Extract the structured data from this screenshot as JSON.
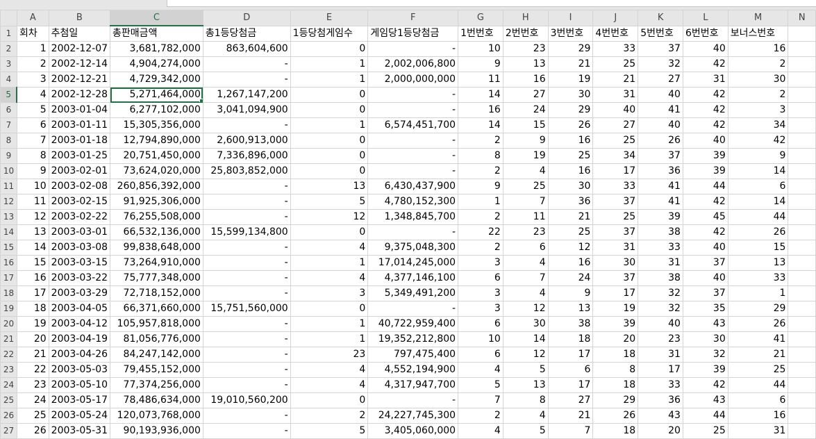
{
  "columns": [
    "A",
    "B",
    "C",
    "D",
    "E",
    "F",
    "G",
    "H",
    "I",
    "J",
    "K",
    "L",
    "M",
    "N"
  ],
  "header_row": [
    "회차",
    "추첨일",
    "총판매금액",
    "총1등당첨금",
    "1등당첨게임수",
    "게임당1등당첨금",
    "1번번호",
    "2번번호",
    "3번번호",
    "4번번호",
    "5번번호",
    "6번번호",
    "보너스번호"
  ],
  "rows": [
    [
      "1",
      "2002-12-07",
      "3,681,782,000",
      "863,604,600",
      "0",
      "-",
      "10",
      "23",
      "29",
      "33",
      "37",
      "40",
      "16"
    ],
    [
      "2",
      "2002-12-14",
      "4,904,274,000",
      "-",
      "1",
      "2,002,006,800",
      "9",
      "13",
      "21",
      "25",
      "32",
      "42",
      "2"
    ],
    [
      "3",
      "2002-12-21",
      "4,729,342,000",
      "-",
      "1",
      "2,000,000,000",
      "11",
      "16",
      "19",
      "21",
      "27",
      "31",
      "30"
    ],
    [
      "4",
      "2002-12-28",
      "5,271,464,000",
      "1,267,147,200",
      "0",
      "-",
      "14",
      "27",
      "30",
      "31",
      "40",
      "42",
      "2"
    ],
    [
      "5",
      "2003-01-04",
      "6,277,102,000",
      "3,041,094,900",
      "0",
      "-",
      "16",
      "24",
      "29",
      "40",
      "41",
      "42",
      "3"
    ],
    [
      "6",
      "2003-01-11",
      "15,305,356,000",
      "-",
      "1",
      "6,574,451,700",
      "14",
      "15",
      "26",
      "27",
      "40",
      "42",
      "34"
    ],
    [
      "7",
      "2003-01-18",
      "12,794,890,000",
      "2,600,913,000",
      "0",
      "-",
      "2",
      "9",
      "16",
      "25",
      "26",
      "40",
      "42"
    ],
    [
      "8",
      "2003-01-25",
      "20,751,450,000",
      "7,336,896,000",
      "0",
      "-",
      "8",
      "19",
      "25",
      "34",
      "37",
      "39",
      "9"
    ],
    [
      "9",
      "2003-02-01",
      "73,624,020,000",
      "25,803,852,000",
      "0",
      "-",
      "2",
      "4",
      "16",
      "17",
      "36",
      "39",
      "14"
    ],
    [
      "10",
      "2003-02-08",
      "260,856,392,000",
      "-",
      "13",
      "6,430,437,900",
      "9",
      "25",
      "30",
      "33",
      "41",
      "44",
      "6"
    ],
    [
      "11",
      "2003-02-15",
      "91,925,306,000",
      "-",
      "5",
      "4,780,152,300",
      "1",
      "7",
      "36",
      "37",
      "41",
      "42",
      "14"
    ],
    [
      "12",
      "2003-02-22",
      "76,255,508,000",
      "-",
      "12",
      "1,348,845,700",
      "2",
      "11",
      "21",
      "25",
      "39",
      "45",
      "44"
    ],
    [
      "13",
      "2003-03-01",
      "66,532,136,000",
      "15,599,134,800",
      "0",
      "-",
      "22",
      "23",
      "25",
      "37",
      "38",
      "42",
      "26"
    ],
    [
      "14",
      "2003-03-08",
      "99,838,648,000",
      "-",
      "4",
      "9,375,048,300",
      "2",
      "6",
      "12",
      "31",
      "33",
      "40",
      "15"
    ],
    [
      "15",
      "2003-03-15",
      "73,264,910,000",
      "-",
      "1",
      "17,014,245,000",
      "3",
      "4",
      "16",
      "30",
      "31",
      "37",
      "13"
    ],
    [
      "16",
      "2003-03-22",
      "75,777,348,000",
      "-",
      "4",
      "4,377,146,100",
      "6",
      "7",
      "24",
      "37",
      "38",
      "40",
      "33"
    ],
    [
      "17",
      "2003-03-29",
      "72,718,152,000",
      "-",
      "3",
      "5,349,491,200",
      "3",
      "4",
      "9",
      "17",
      "32",
      "37",
      "1"
    ],
    [
      "18",
      "2003-04-05",
      "66,371,660,000",
      "15,751,560,000",
      "0",
      "-",
      "3",
      "12",
      "13",
      "19",
      "32",
      "35",
      "29"
    ],
    [
      "19",
      "2003-04-12",
      "105,957,818,000",
      "-",
      "1",
      "40,722,959,400",
      "6",
      "30",
      "38",
      "39",
      "40",
      "43",
      "26"
    ],
    [
      "20",
      "2003-04-19",
      "81,056,776,000",
      "-",
      "1",
      "19,352,212,800",
      "10",
      "14",
      "18",
      "20",
      "23",
      "30",
      "41"
    ],
    [
      "21",
      "2003-04-26",
      "84,247,142,000",
      "-",
      "23",
      "797,475,400",
      "6",
      "12",
      "17",
      "18",
      "31",
      "32",
      "21"
    ],
    [
      "22",
      "2003-05-03",
      "79,455,152,000",
      "-",
      "4",
      "4,552,194,900",
      "4",
      "5",
      "6",
      "8",
      "17",
      "39",
      "25"
    ],
    [
      "23",
      "2003-05-10",
      "77,374,256,000",
      "-",
      "4",
      "4,317,947,700",
      "5",
      "13",
      "17",
      "18",
      "33",
      "42",
      "44"
    ],
    [
      "24",
      "2003-05-17",
      "78,486,634,000",
      "19,010,560,200",
      "0",
      "-",
      "7",
      "8",
      "27",
      "29",
      "36",
      "43",
      "6"
    ],
    [
      "25",
      "2003-05-24",
      "120,073,768,000",
      "-",
      "2",
      "24,227,745,300",
      "2",
      "4",
      "21",
      "26",
      "43",
      "44",
      "16"
    ],
    [
      "26",
      "2003-05-31",
      "90,193,936,000",
      "-",
      "5",
      "3,405,060,000",
      "4",
      "5",
      "7",
      "18",
      "20",
      "25",
      "31"
    ]
  ],
  "selected": {
    "row": 5,
    "col": "C"
  },
  "colors": {
    "accent": "#217346",
    "gridline": "#d4d4d4",
    "header_bg": "#e6e6e6"
  }
}
